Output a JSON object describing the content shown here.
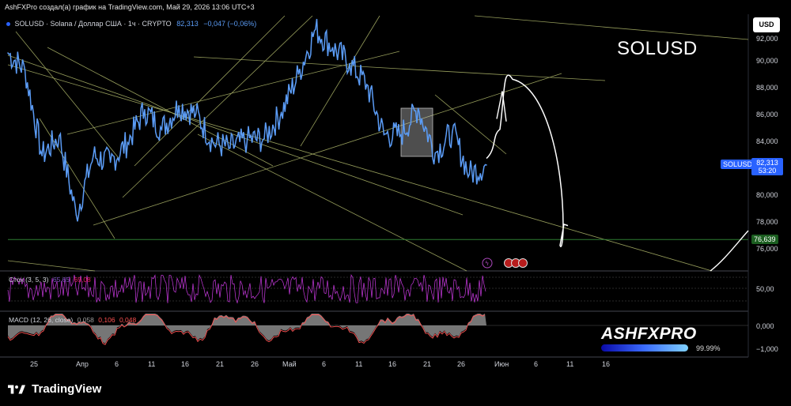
{
  "header": {
    "caption": "AshFXPro создал(а) график на TradingView.com, Май 29, 2026 13:06 UTC+3"
  },
  "legend": {
    "symbol_text": "SOLUSD · Solana / Доллар США · 1ч · CRYPTO",
    "last": "82,313",
    "change": "−0,047 (−0,06%)"
  },
  "overlay_title": "SOLUSD",
  "currency_button": "USD",
  "price_labels": {
    "symbol": "SOLUSD",
    "price": "82,313",
    "countdown": "53:20",
    "support": "76,639"
  },
  "y_ticks": [
    "92,000",
    "90,000",
    "88,000",
    "86,000",
    "84,000",
    "80,000",
    "78,000",
    "76,000"
  ],
  "x_ticks": [
    "25",
    "Апр",
    "6",
    "11",
    "16",
    "21",
    "26",
    "Май",
    "6",
    "11",
    "16",
    "21",
    "26",
    "Июн",
    "6",
    "11",
    "16"
  ],
  "stoch": {
    "label": "Стох (3, 5, 3)",
    "k": "65,65",
    "d": "69,08",
    "tick": "50,00"
  },
  "macd": {
    "label": "MACD (12, 26, close)",
    "hist": "0,058",
    "macd": "0,106",
    "signal": "0,048",
    "tick_zero": "0,000",
    "tick_neg": "−1,000"
  },
  "brand": {
    "name": "ASHFXPRO",
    "percent": "99.99%"
  },
  "footer": {
    "logo_text": "TradingView"
  },
  "colors": {
    "price_line": "#5b9cf6",
    "trend_lines": "#c8d27a",
    "support_line": "#2e7d32",
    "stoch_line": "#e040fb",
    "macd_fill": "#9e9e9e",
    "macd_line": "#ff5252",
    "accent": "#2962ff"
  },
  "chart_data": {
    "type": "line",
    "title": "SOLUSD",
    "ylabel": "USD",
    "ylim": [
      75.0,
      92.8
    ],
    "x": [
      "Mar 25",
      "Mar 28",
      "Apr 1",
      "Apr 4",
      "Apr 6",
      "Apr 9",
      "Apr 11",
      "Apr 14",
      "Apr 16",
      "Apr 19",
      "Apr 21",
      "Apr 24",
      "Apr 26",
      "Apr 29",
      "May 1",
      "May 4",
      "May 6",
      "May 8",
      "May 10",
      "May 12",
      "May 14",
      "May 16",
      "May 18",
      "May 20",
      "May 22",
      "May 24",
      "May 26",
      "May 28",
      "May 29"
    ],
    "series": [
      {
        "values": [
          90.8,
          89.5,
          83.0,
          84.5,
          78.5,
          83.0,
          82.5,
          84.0,
          86.5,
          85.0,
          86.8,
          86.2,
          84.0,
          83.6,
          84.2,
          84.3,
          86.3,
          89.2,
          92.6,
          91.2,
          90.0,
          88.4,
          84.6,
          84.6,
          86.6,
          83.2,
          84.8,
          81.6,
          82.3
        ]
      }
    ],
    "support_level": 76.639,
    "projection": {
      "values": [
        82.3,
        88.8,
        77.6,
        76.2
      ]
    }
  }
}
